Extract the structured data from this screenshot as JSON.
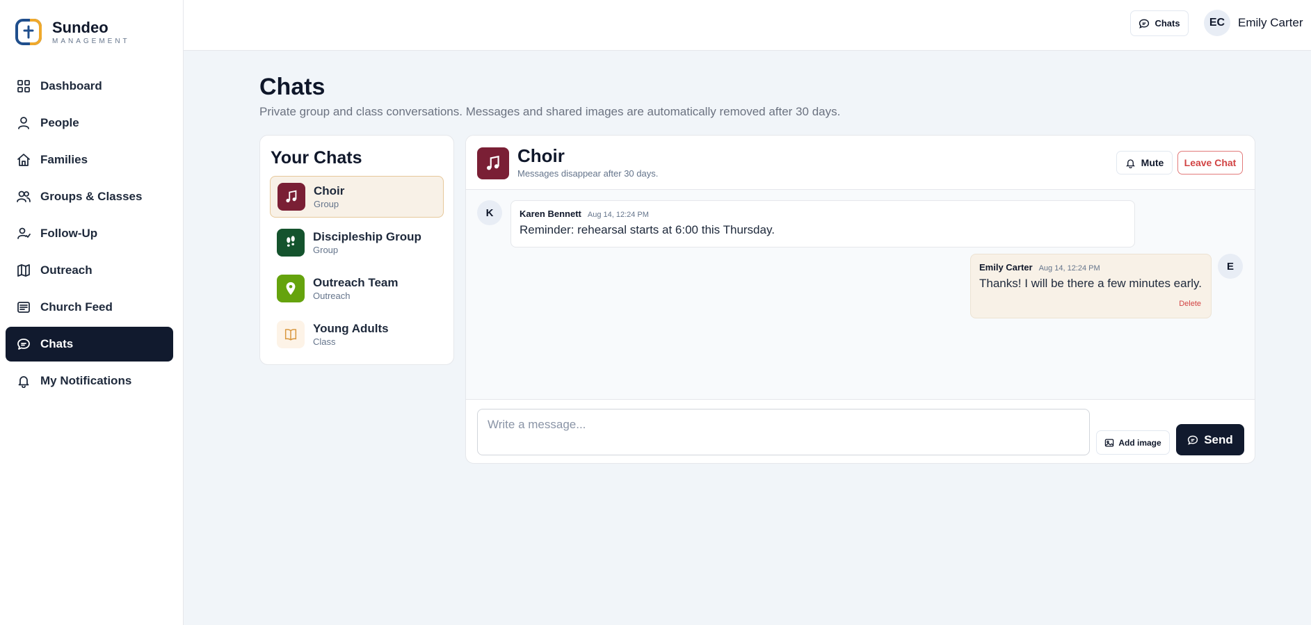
{
  "brand": {
    "name": "Sundeo",
    "subtitle": "MANAGEMENT"
  },
  "sidebar": {
    "items": [
      {
        "label": "Dashboard",
        "icon": "grid-icon",
        "active": false
      },
      {
        "label": "People",
        "icon": "person-icon",
        "active": false
      },
      {
        "label": "Families",
        "icon": "home-icon",
        "active": false
      },
      {
        "label": "Groups & Classes",
        "icon": "users-icon",
        "active": false
      },
      {
        "label": "Follow-Up",
        "icon": "user-follow-icon",
        "active": false
      },
      {
        "label": "Outreach",
        "icon": "map-icon",
        "active": false
      },
      {
        "label": "Church Feed",
        "icon": "feed-icon",
        "active": false
      },
      {
        "label": "Chats",
        "icon": "chat-icon",
        "active": true
      },
      {
        "label": "My Notifications",
        "icon": "bell-icon",
        "active": false
      }
    ]
  },
  "topbar": {
    "chats_label": "Chats",
    "user_initials": "EC",
    "user_name": "Emily Carter"
  },
  "page": {
    "title": "Chats",
    "subtitle": "Private group and class conversations. Messages and shared images are automatically removed after 30 days."
  },
  "chat_list": {
    "title": "Your Chats",
    "items": [
      {
        "name": "Choir",
        "type": "Group",
        "icon": "music-note-icon",
        "color": "#7a1f35",
        "active": true
      },
      {
        "name": "Discipleship Group",
        "type": "Group",
        "icon": "footprints-icon",
        "color": "#14532d",
        "active": false
      },
      {
        "name": "Outreach Team",
        "type": "Outreach",
        "icon": "map-pin-icon",
        "color": "#65a30d",
        "active": false
      },
      {
        "name": "Young Adults",
        "type": "Class",
        "icon": "book-icon",
        "color": "#fdf3e7",
        "active": false
      }
    ]
  },
  "conversation": {
    "title": "Choir",
    "subtitle": "Messages disappear after 30 days.",
    "mute_label": "Mute",
    "leave_label": "Leave Chat",
    "messages": [
      {
        "initial": "K",
        "author": "Karen Bennett",
        "time": "Aug 14, 12:24 PM",
        "text": "Reminder: rehearsal starts at 6:00 this Thursday.",
        "own": false
      },
      {
        "initial": "E",
        "author": "Emily Carter",
        "time": "Aug 14, 12:24 PM",
        "text": "Thanks! I will be there a few minutes early.",
        "own": true,
        "delete_label": "Delete"
      }
    ],
    "composer_placeholder": "Write a message...",
    "add_image_label": "Add image",
    "send_label": "Send"
  },
  "colors": {
    "accent_dark": "#111a2e",
    "danger": "#d14343",
    "highlight": "#f8f1e7"
  }
}
